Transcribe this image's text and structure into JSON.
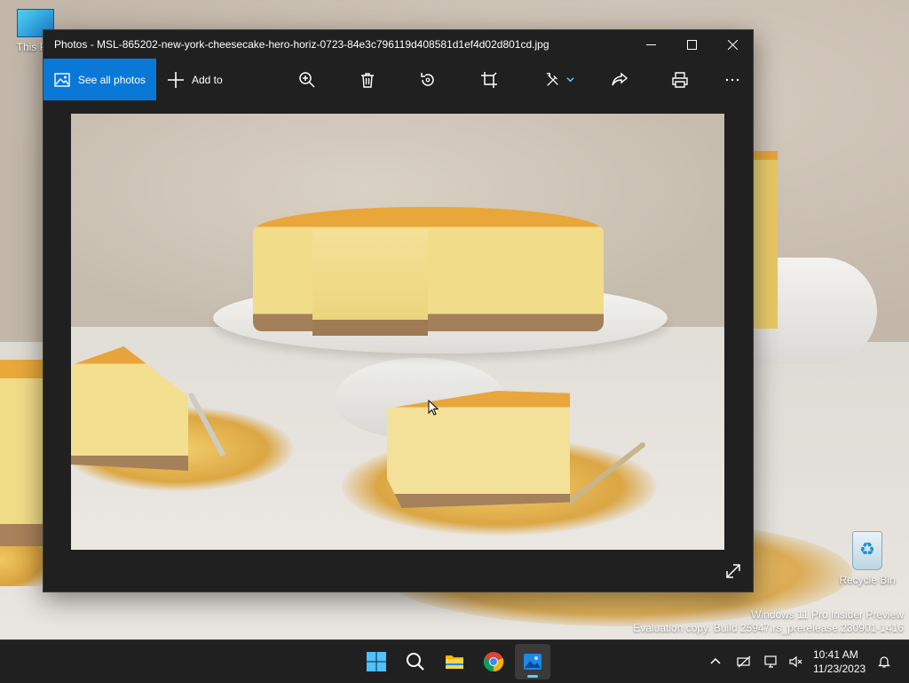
{
  "desktop": {
    "icons": [
      {
        "label": "This PC"
      },
      {
        "label": "Recycle Bin"
      }
    ],
    "watermark": {
      "line1": "Windows 11 Pro Insider Preview",
      "line2": "Evaluation copy. Build 25947.rs_prerelease.230901-1416"
    }
  },
  "window": {
    "title": "Photos - MSL-865202-new-york-cheesecake-hero-horiz-0723-84e3c796119d408581d1ef4d02d801cd.jpg",
    "toolbar": {
      "see_all_label": "See all photos",
      "add_to_label": "Add to",
      "tools": [
        "zoom-in",
        "delete",
        "rotate",
        "crop",
        "edit",
        "share",
        "print",
        "more"
      ]
    },
    "accent_color": "#0a78d7"
  },
  "taskbar": {
    "apps": [
      "start",
      "search",
      "file-explorer",
      "chrome",
      "photos"
    ],
    "active_app": "photos",
    "clock": {
      "time": "10:41 AM",
      "date": "11/23/2023"
    }
  }
}
